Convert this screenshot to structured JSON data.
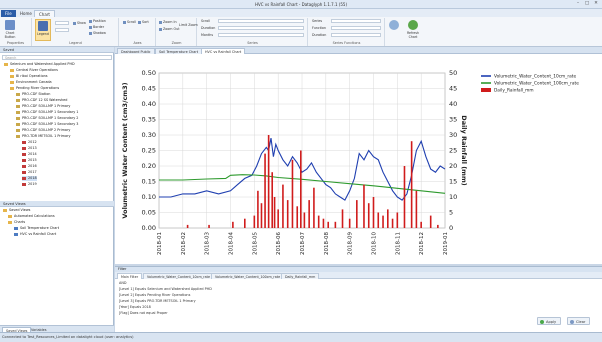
{
  "window": {
    "title": "HVC vs Rainfall Chart - Dataglyph 1.1.7.1 (55)"
  },
  "ribbon_tabs": [
    "File",
    "Home",
    "Chart"
  ],
  "ribbon": {
    "chart_button": "Chart Button",
    "legend_label": "Legend",
    "show_label": "Show",
    "position_label": "Position",
    "border_label": "Border",
    "shadow_label": "Shadow",
    "zoom_in": "Zoom In",
    "zoom_out": "Zoom Out",
    "limit_zoom": "Limit Zoom",
    "scroll_label": "Scroll",
    "sort_label": "Sort",
    "scroll_fields": [
      "Scroll",
      "Duration",
      "Months"
    ],
    "series_fields": [
      "Series",
      "Function",
      "Duration"
    ],
    "refresh_label": "Refresh Chart",
    "groups": [
      "Properties",
      "Legend",
      "Axes",
      "Zoom",
      "Series",
      "Series Functions"
    ]
  },
  "left_panel": {
    "header": "Saved",
    "search_placeholder": "Search",
    "tree": [
      "Selenium and Watershed Applied PHD",
      "Central River Operations",
      "Bl riboi Operations",
      "Environment Canada",
      "Pending River Operations",
      "PRO-CDF Station",
      "PRO-CDF 12 SS Watershed",
      "PRO-CDF SOILLMP 1 Primary",
      "PRO-CDF SOILLMP 1 Secondary 1",
      "PRO-CDF SOILLMP 1 Secondary 2",
      "PRO-CDF SOILLMP 1 Secondary 3",
      "PRO-CDF SOILLMP 2 Primary",
      "PRO-TDR METSOIL 1 Primary",
      "2012",
      "2013",
      "2014",
      "2015",
      "2016",
      "2017",
      "2018",
      "2019"
    ],
    "saved_header": "Saved Views",
    "saved_tree": [
      "Saved Views",
      "Automated Calculations",
      "Charts",
      "Soil Temperature Chart",
      "HVC vs Rainfall Chart"
    ],
    "tabs": [
      "Saved Views",
      "Variables"
    ]
  },
  "doc_tabs": [
    "Dashboard Public",
    "Soil Temperature Chart",
    "HVC vs Rainfall Chart"
  ],
  "chart_data": {
    "type": "line",
    "ylabel": "Volumetric Water Content (cm3/cm3)",
    "y2label": "Daily Rainfall (mm)",
    "ylim": [
      0,
      0.5
    ],
    "y2lim": [
      0,
      50
    ],
    "yticks": [
      "0.00",
      "0.05",
      "0.10",
      "0.15",
      "0.20",
      "0.25",
      "0.30",
      "0.35",
      "0.40",
      "0.45",
      "0.50"
    ],
    "y2ticks": [
      "0",
      "5",
      "10",
      "15",
      "20",
      "25",
      "30",
      "35",
      "40",
      "45",
      "50"
    ],
    "xticks": [
      "2018-01",
      "2018-02",
      "2018-03",
      "2018-04",
      "2018-05",
      "2018-06",
      "2018-07",
      "2018-08",
      "2018-09",
      "2018-10",
      "2018-11",
      "2018-12",
      "2019-01"
    ],
    "grid": true,
    "legend_position": "right",
    "series": [
      {
        "name": "Volumetric_Water_Content_10cm_rate",
        "color": "#1f3fb0",
        "axis": "left",
        "x": [
          0.0,
          0.5,
          1.0,
          1.5,
          2.0,
          2.5,
          3.0,
          3.3,
          3.6,
          3.9,
          4.1,
          4.3,
          4.5,
          4.6,
          4.7,
          4.8,
          4.9,
          5.0,
          5.2,
          5.4,
          5.6,
          5.8,
          6.0,
          6.2,
          6.4,
          6.6,
          6.8,
          7.0,
          7.2,
          7.4,
          7.6,
          7.8,
          8.0,
          8.2,
          8.4,
          8.6,
          8.8,
          9.0,
          9.2,
          9.4,
          9.6,
          9.8,
          10.0,
          10.2,
          10.4,
          10.6,
          10.8,
          11.0,
          11.2,
          11.4,
          11.6,
          11.8,
          12.0
        ],
        "y": [
          0.1,
          0.1,
          0.11,
          0.11,
          0.12,
          0.11,
          0.12,
          0.14,
          0.16,
          0.17,
          0.2,
          0.24,
          0.26,
          0.25,
          0.29,
          0.23,
          0.27,
          0.25,
          0.22,
          0.2,
          0.23,
          0.21,
          0.18,
          0.19,
          0.21,
          0.18,
          0.16,
          0.14,
          0.13,
          0.11,
          0.1,
          0.09,
          0.12,
          0.16,
          0.24,
          0.22,
          0.25,
          0.23,
          0.22,
          0.18,
          0.15,
          0.12,
          0.1,
          0.09,
          0.11,
          0.17,
          0.25,
          0.28,
          0.23,
          0.19,
          0.18,
          0.2,
          0.19
        ]
      },
      {
        "name": "Volumetric_Water_Content_100cm_rate",
        "color": "#2e9a2e",
        "axis": "left",
        "x": [
          0.0,
          1.0,
          2.0,
          2.8,
          3.0,
          3.5,
          4.0,
          4.5,
          5.0,
          6.0,
          7.0,
          8.0,
          9.0,
          10.0,
          11.0,
          12.0
        ],
        "y": [
          0.155,
          0.155,
          0.158,
          0.16,
          0.17,
          0.172,
          0.171,
          0.168,
          0.163,
          0.157,
          0.15,
          0.143,
          0.136,
          0.128,
          0.12,
          0.112
        ]
      },
      {
        "name": "Daily_Rainfall_mm",
        "color": "#d01c1c",
        "axis": "right",
        "kind": "bar",
        "x": [
          1.2,
          2.1,
          3.1,
          3.6,
          4.0,
          4.15,
          4.3,
          4.45,
          4.6,
          4.75,
          4.85,
          5.0,
          5.2,
          5.4,
          5.6,
          5.8,
          5.95,
          6.1,
          6.3,
          6.5,
          6.7,
          6.9,
          7.1,
          7.4,
          7.7,
          8.0,
          8.3,
          8.6,
          8.8,
          9.0,
          9.2,
          9.4,
          9.6,
          9.8,
          10.0,
          10.3,
          10.6,
          10.8,
          11.0,
          11.4,
          11.7
        ],
        "y": [
          1,
          1,
          2,
          3,
          4,
          12,
          8,
          24,
          30,
          18,
          10,
          6,
          14,
          9,
          22,
          7,
          25,
          5,
          9,
          13,
          4,
          3,
          2,
          2,
          6,
          3,
          9,
          14,
          8,
          10,
          5,
          4,
          6,
          3,
          5,
          20,
          28,
          12,
          2,
          4,
          1
        ]
      }
    ]
  },
  "filter_pane": {
    "header": "Filter",
    "tabs": [
      "Main Filter",
      "Volumetric_Water_Content_10cm_rate",
      "Volumetric_Water_Content_100cm_rate",
      "Daily_Rainfall_mm"
    ],
    "lines": [
      "AND",
      "[Level 1] Equals Selenium and Watershed Applied PHD",
      "[Level 2] Equals Pending River Operations",
      "[Level 3] Equals PRO-TDR METSOIL 1 Primary",
      "[Year] Equals 2018",
      "[Flag] Does not equal Proper"
    ],
    "apply_label": "Apply",
    "clear_label": "Clear"
  },
  "status": {
    "text": "Connected to Test_Resources_Limited on datalight cloud (user: analytics)"
  }
}
